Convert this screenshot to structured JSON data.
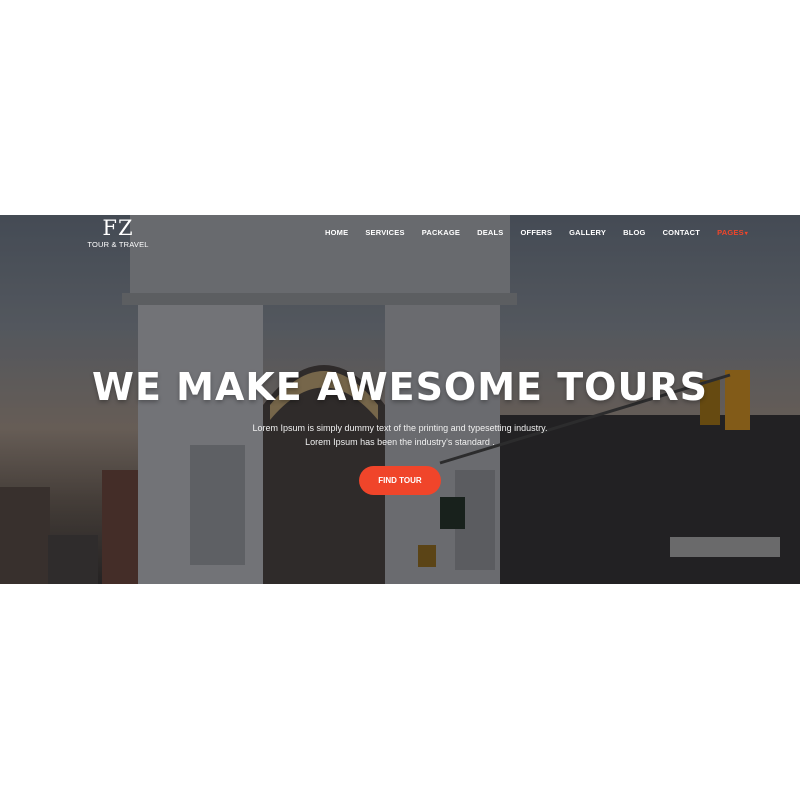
{
  "logo": {
    "mark": "FZ",
    "subtitle": "TOUR & TRAVEL"
  },
  "nav": {
    "items": [
      {
        "label": "HOME"
      },
      {
        "label": "SERVICES"
      },
      {
        "label": "PACKAGE"
      },
      {
        "label": "DEALS"
      },
      {
        "label": "OFFERS"
      },
      {
        "label": "GALLERY"
      },
      {
        "label": "BLOG"
      },
      {
        "label": "CONTACT"
      },
      {
        "label": "PAGES"
      }
    ],
    "active_color": "#f0452a"
  },
  "hero": {
    "headline": "WE MAKE AWESOME TOURS",
    "line1": "Lorem Ipsum is simply dummy text of the printing and typesetting industry.",
    "line2": "Lorem Ipsum has been the industry's standard .",
    "cta_label": "FIND TOUR",
    "accent": "#f0452a"
  }
}
